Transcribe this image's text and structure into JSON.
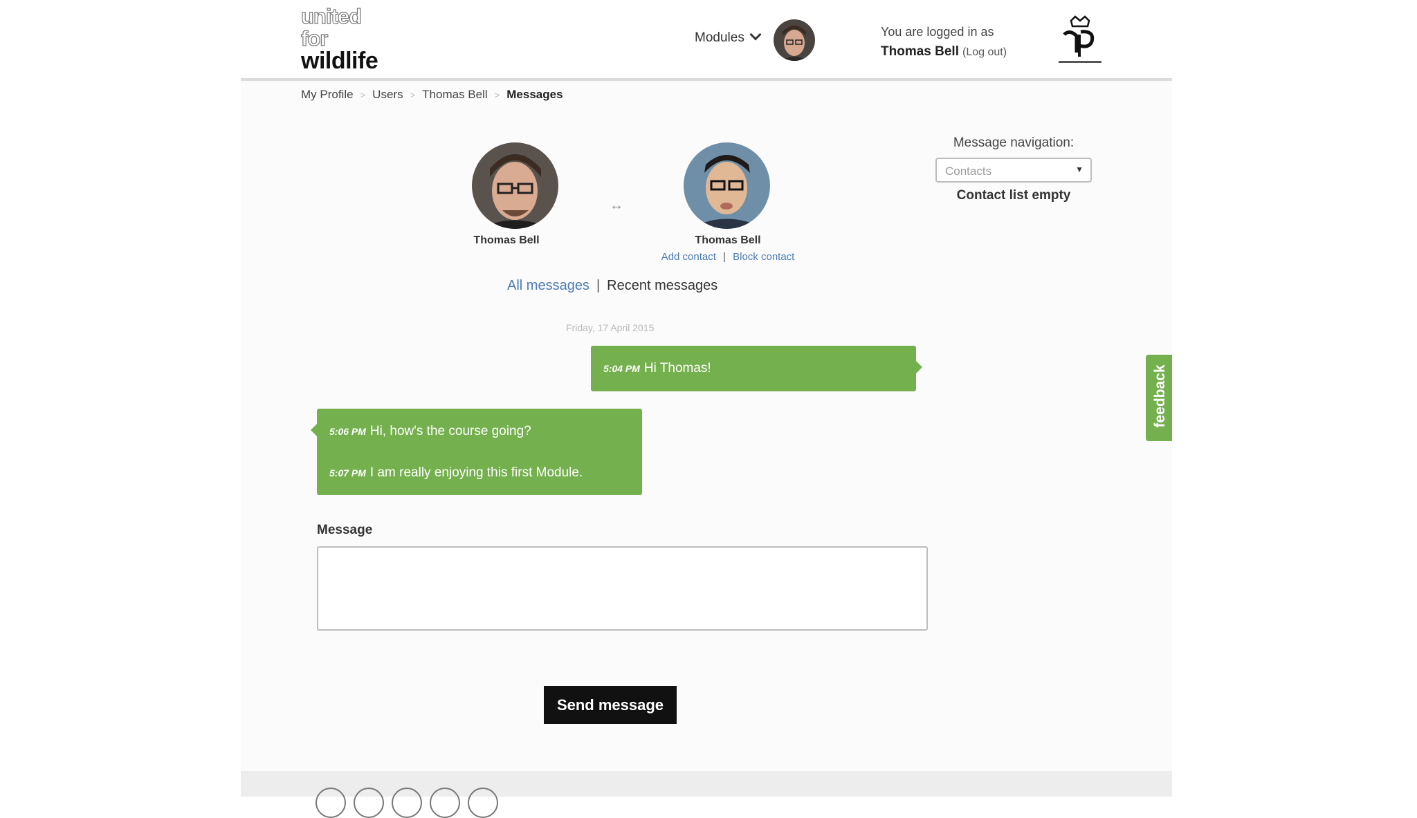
{
  "header": {
    "logo_lines": [
      "united",
      "for",
      "wildlife"
    ],
    "modules_label": "Modules",
    "login_prefix": "You are logged in as",
    "user_name": "Thomas Bell",
    "logout_label": "(Log out)"
  },
  "breadcrumb": {
    "items": [
      "My Profile",
      "Users",
      "Thomas Bell"
    ],
    "current": "Messages",
    "separator": ">"
  },
  "conversation": {
    "me_name": "Thomas Bell",
    "other_name": "Thomas Bell",
    "arrows": "↔",
    "add_contact": "Add contact",
    "block_contact": "Block contact",
    "action_sep": "|"
  },
  "message_navigation": {
    "label": "Message navigation:",
    "select_value": "Contacts",
    "empty_text": "Contact list empty"
  },
  "tabs": {
    "all": "All messages",
    "sep": "|",
    "recent": "Recent messages"
  },
  "thread": {
    "date": "Friday, 17 April 2015",
    "messages": [
      {
        "time": "5:04 PM",
        "text": "Hi Thomas!",
        "side": "right"
      },
      {
        "time": "5:06 PM",
        "text": "Hi, how's the course going?",
        "side": "left"
      },
      {
        "time": "5:07 PM",
        "text": "I am really enjoying this first Module.",
        "side": "left"
      }
    ]
  },
  "composer": {
    "label": "Message",
    "value": "",
    "send_label": "Send message"
  },
  "feedback_label": "feedback",
  "colors": {
    "accent_green": "#74b14e",
    "link_blue": "#4a7bb3",
    "button_black": "#111111"
  }
}
